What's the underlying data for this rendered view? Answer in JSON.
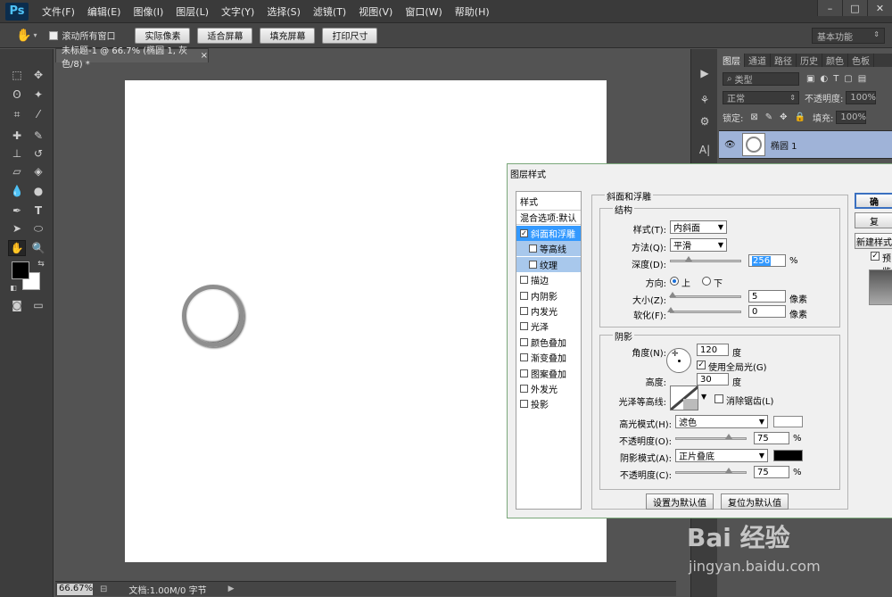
{
  "app": {
    "logo": "Ps",
    "menu": [
      "文件(F)",
      "编辑(E)",
      "图像(I)",
      "图层(L)",
      "文字(Y)",
      "选择(S)",
      "滤镜(T)",
      "视图(V)",
      "窗口(W)",
      "帮助(H)"
    ],
    "window_controls": [
      "–",
      "□",
      "✕"
    ]
  },
  "options_bar": {
    "scroll_all_label": "滚动所有窗口",
    "buttons": [
      "实际像素",
      "适合屏幕",
      "填充屏幕",
      "打印尺寸"
    ],
    "workspace": "基本功能"
  },
  "document": {
    "tab_title": "未标题-1 @ 66.7% (椭圆 1, 灰色/8) *",
    "tab_close": "×",
    "zoom": "66.67%",
    "doc_info": "文档:1.00M/0 字节"
  },
  "layers_panel": {
    "tabs": [
      "图层",
      "通道",
      "路径",
      "历史",
      "颜色",
      "色板"
    ],
    "filter_label": "类型",
    "blend_mode": "正常",
    "opacity_label": "不透明度:",
    "opacity_value": "100%",
    "lock_label": "锁定:",
    "fill_label": "填充:",
    "fill_value": "100%",
    "layer_name": "椭圆 1"
  },
  "watermark": {
    "logo": "Bai 经验",
    "url": "jingyan.baidu.com"
  },
  "dialog": {
    "title": "图层样式",
    "style_list_header": "样式",
    "blend_options": "混合选项:默认",
    "styles": [
      {
        "label": "斜面和浮雕",
        "checked": true,
        "selected": true,
        "sub": false
      },
      {
        "label": "等高线",
        "checked": false,
        "selected": false,
        "sub": true
      },
      {
        "label": "纹理",
        "checked": false,
        "selected": false,
        "sub": true
      },
      {
        "label": "描边",
        "checked": false,
        "selected": false,
        "sub": false
      },
      {
        "label": "内阴影",
        "checked": false,
        "selected": false,
        "sub": false
      },
      {
        "label": "内发光",
        "checked": false,
        "selected": false,
        "sub": false
      },
      {
        "label": "光泽",
        "checked": false,
        "selected": false,
        "sub": false
      },
      {
        "label": "颜色叠加",
        "checked": false,
        "selected": false,
        "sub": false
      },
      {
        "label": "渐变叠加",
        "checked": false,
        "selected": false,
        "sub": false
      },
      {
        "label": "图案叠加",
        "checked": false,
        "selected": false,
        "sub": false
      },
      {
        "label": "外发光",
        "checked": false,
        "selected": false,
        "sub": false
      },
      {
        "label": "投影",
        "checked": false,
        "selected": false,
        "sub": false
      }
    ],
    "bevel_title": "斜面和浮雕",
    "structure_title": "结构",
    "style_label": "样式(T):",
    "style_value": "内斜面",
    "technique_label": "方法(Q):",
    "technique_value": "平滑",
    "depth_label": "深度(D):",
    "depth_value": "256",
    "depth_level": 0.256,
    "percent": "%",
    "direction_label": "方向:",
    "dir_up": "上",
    "dir_down": "下",
    "size_label": "大小(Z):",
    "size_value": "5",
    "size_level": 0.02,
    "soften_label": "软化(F):",
    "soften_value": "0",
    "soften_level": 0,
    "px_unit": "像素",
    "shading_title": "阴影",
    "angle_label": "角度(N):",
    "angle_value": "120",
    "degree": "度",
    "global_light": "使用全局光(G)",
    "altitude_label": "高度:",
    "altitude_value": "30",
    "gloss_label": "光泽等高线:",
    "anti_alias": "消除锯齿(L)",
    "highlight_mode_label": "高光模式(H):",
    "highlight_mode": "滤色",
    "highlight_color": "#ffffff",
    "hl_opacity_label": "不透明度(O):",
    "hl_opacity_value": "75",
    "hl_opacity_level": 0.75,
    "shadow_mode_label": "阴影模式(A):",
    "shadow_mode": "正片叠底",
    "shadow_color": "#000000",
    "sh_opacity_label": "不透明度(C):",
    "sh_opacity_value": "75",
    "sh_opacity_level": 0.75,
    "make_default": "设置为默认值",
    "reset_default": "复位为默认值",
    "ok_btn": "确",
    "reset_btn": "复",
    "new_style_btn": "新建样式",
    "preview_label": "预览"
  }
}
